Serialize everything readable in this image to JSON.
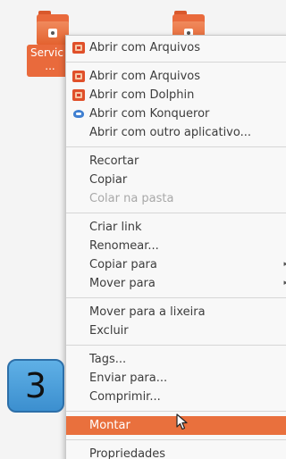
{
  "desktop": {
    "folder1_label_line1": "Servic",
    "folder1_label_line2": "..."
  },
  "menu": {
    "items": [
      {
        "label": "Abrir com Arquivos",
        "icon": "files-app-icon"
      },
      {
        "label": "Abrir com Arquivos",
        "icon": "files-app-icon"
      },
      {
        "label": "Abrir com Dolphin",
        "icon": "dolphin-app-icon"
      },
      {
        "label": "Abrir com Konqueror",
        "icon": "konqueror-app-icon"
      },
      {
        "label": "Abrir com outro aplicativo..."
      },
      {
        "label": "Recortar"
      },
      {
        "label": "Copiar"
      },
      {
        "label": "Colar na pasta",
        "disabled": true
      },
      {
        "label": "Criar link"
      },
      {
        "label": "Renomear..."
      },
      {
        "label": "Copiar para",
        "submenu": true
      },
      {
        "label": "Mover para",
        "submenu": true
      },
      {
        "label": "Mover para a lixeira"
      },
      {
        "label": "Excluir"
      },
      {
        "label": "Tags..."
      },
      {
        "label": "Enviar para..."
      },
      {
        "label": "Comprimir..."
      },
      {
        "label": "Montar",
        "active": true
      },
      {
        "label": "Propriedades"
      }
    ],
    "submenu_arrow": "▸"
  },
  "annotation": {
    "step_number": "3"
  },
  "colors": {
    "accent": "#e9703d",
    "badge": "#4aa0dc"
  }
}
